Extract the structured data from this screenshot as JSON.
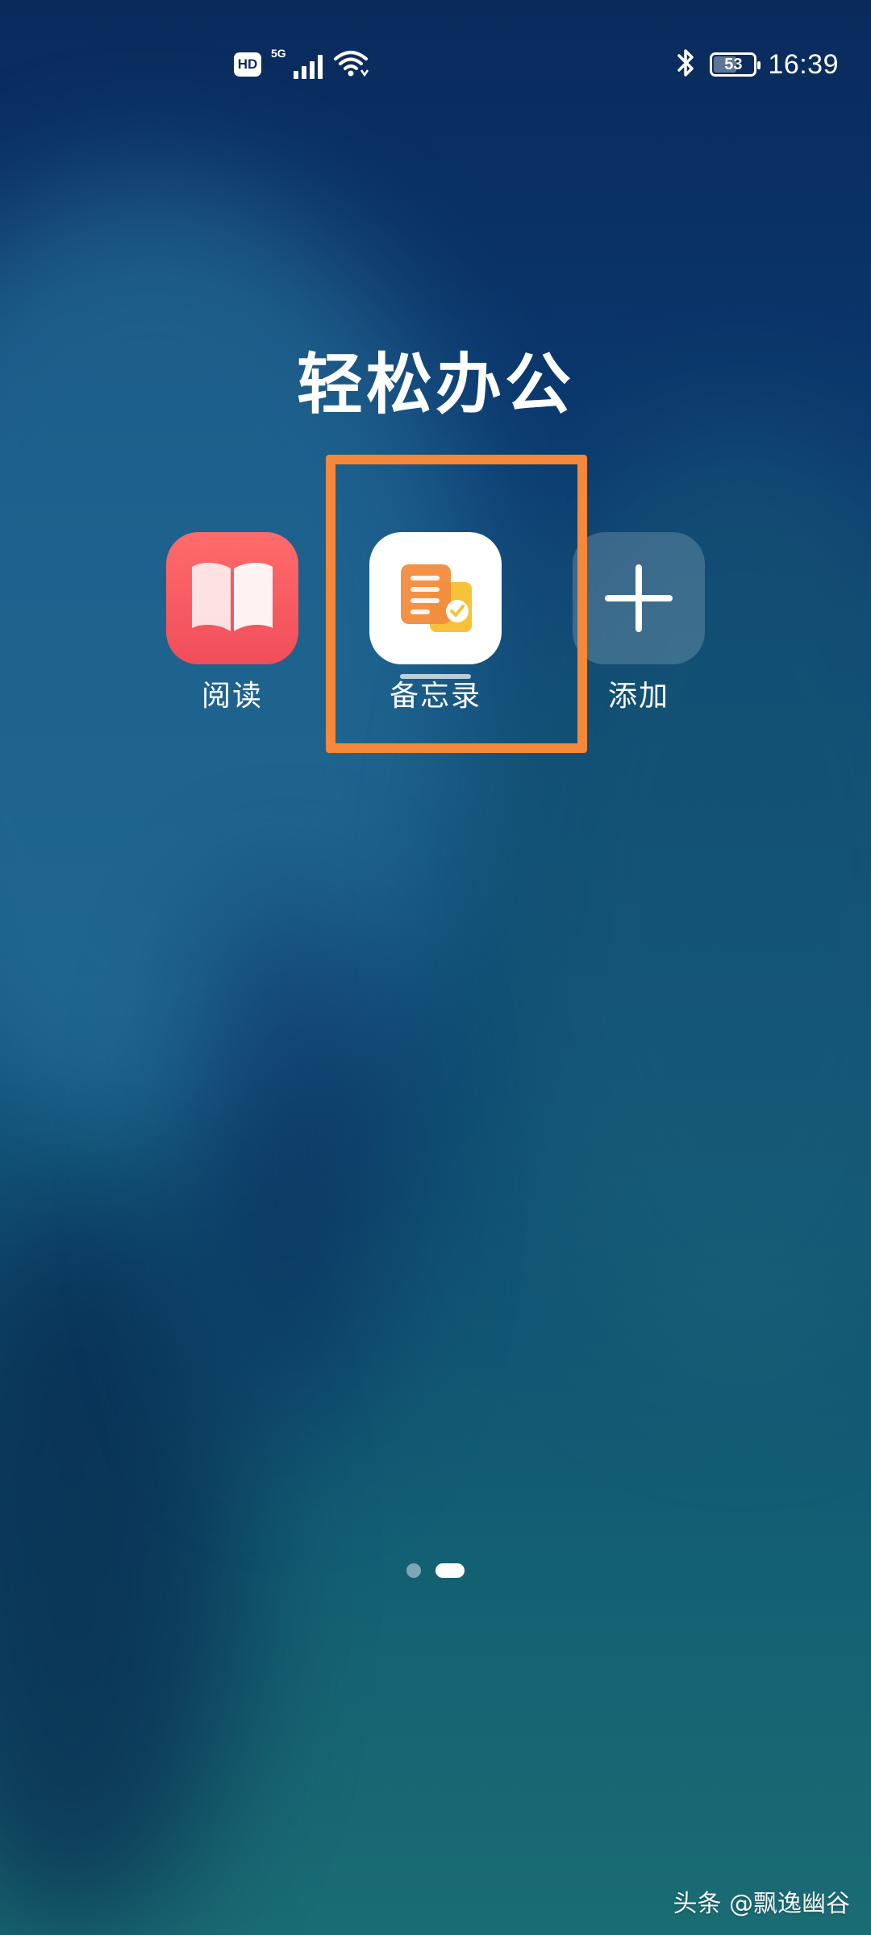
{
  "status_bar": {
    "hd_label": "HD",
    "network_label": "5G",
    "battery_level": "53",
    "battery_fraction": 0.53,
    "time": "16:39",
    "icons": [
      "hd-icon",
      "signal-icon",
      "wifi-icon",
      "bluetooth-icon",
      "battery-icon"
    ]
  },
  "folder": {
    "title": "轻松办公",
    "apps": [
      {
        "label": "阅读",
        "icon": "book-icon",
        "color": "#f04e5a"
      },
      {
        "label": "备忘录",
        "icon": "notes-icon",
        "color": "#ffffff"
      },
      {
        "label": "添加",
        "icon": "plus-icon",
        "color": "#ffffff"
      }
    ],
    "page_indicator": {
      "pages": 2,
      "current": 2
    }
  },
  "highlight_color": "#f5883a",
  "watermark": "头条 @飘逸幽谷"
}
